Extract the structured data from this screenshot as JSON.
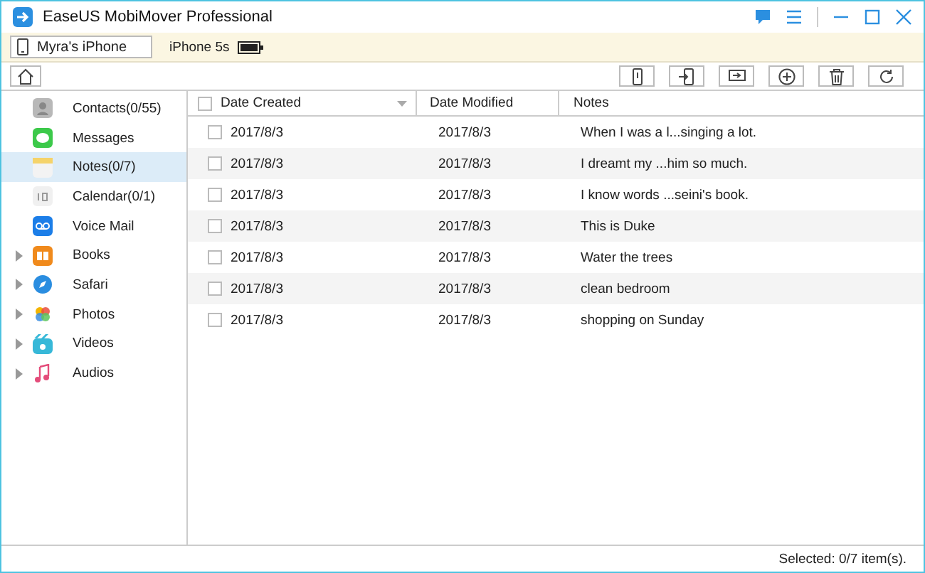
{
  "window": {
    "title": "EaseUS MobiMover Professional"
  },
  "device_bar": {
    "device_name": "Myra's iPhone",
    "model": "iPhone 5s"
  },
  "sidebar": {
    "items": [
      {
        "label": "Contacts(0/55)",
        "selected": false,
        "expandable": false
      },
      {
        "label": "Messages",
        "selected": false,
        "expandable": false
      },
      {
        "label": "Notes(0/7)",
        "selected": true,
        "expandable": false
      },
      {
        "label": "Calendar(0/1)",
        "selected": false,
        "expandable": false
      },
      {
        "label": "Voice Mail",
        "selected": false,
        "expandable": false
      },
      {
        "label": "Books",
        "selected": false,
        "expandable": true
      },
      {
        "label": "Safari",
        "selected": false,
        "expandable": true
      },
      {
        "label": "Photos",
        "selected": false,
        "expandable": true
      },
      {
        "label": "Videos",
        "selected": false,
        "expandable": true
      },
      {
        "label": "Audios",
        "selected": false,
        "expandable": true
      }
    ]
  },
  "table": {
    "select_all_checked": false,
    "columns": [
      "Date Created",
      "Date Modified",
      "Notes"
    ],
    "rows": [
      {
        "created": "2017/8/3",
        "modified": "2017/8/3",
        "note": "When I was a l...singing a lot.",
        "checked": false
      },
      {
        "created": "2017/8/3",
        "modified": "2017/8/3",
        "note": "I dreamt my ...him so much.",
        "checked": false
      },
      {
        "created": "2017/8/3",
        "modified": "2017/8/3",
        "note": "I know words ...seini's book.",
        "checked": false
      },
      {
        "created": "2017/8/3",
        "modified": "2017/8/3",
        "note": "This is Duke",
        "checked": false
      },
      {
        "created": "2017/8/3",
        "modified": "2017/8/3",
        "note": "Water the trees",
        "checked": false
      },
      {
        "created": "2017/8/3",
        "modified": "2017/8/3",
        "note": "clean bedroom",
        "checked": false
      },
      {
        "created": "2017/8/3",
        "modified": "2017/8/3",
        "note": "shopping on Sunday",
        "checked": false
      }
    ]
  },
  "status_bar": {
    "text": "Selected: 0/7 item(s)."
  }
}
